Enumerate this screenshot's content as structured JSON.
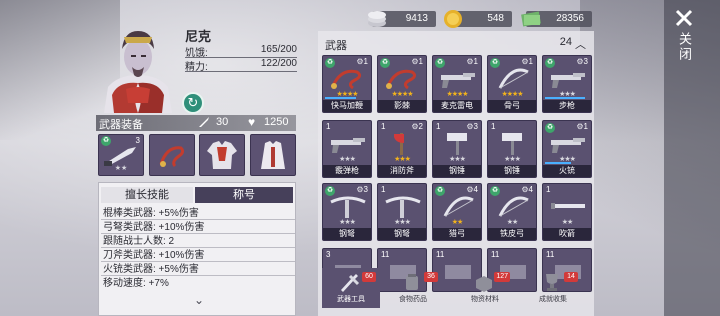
{
  "character": {
    "name": "尼克",
    "stats": [
      {
        "label": "饥饿:",
        "value": "165/200"
      },
      {
        "label": "精力:",
        "value": "122/200"
      }
    ]
  },
  "equipment": {
    "title": "武器装备",
    "attack": "30",
    "hp": "1250",
    "slots": [
      {
        "qty": "3",
        "stars": "★★"
      },
      {
        "qty": "",
        "stars": ""
      },
      {
        "qty": "",
        "stars": ""
      },
      {
        "qty": "",
        "stars": ""
      }
    ]
  },
  "skills": {
    "tabs": [
      "擅长技能",
      "称号"
    ],
    "lines": [
      "棍棒类武器: +5%伤害",
      "弓弩类武器: +10%伤害",
      "跟随战士人数: 2",
      "刀斧类武器: +10%伤害",
      "火铳类武器: +5%伤害",
      "移动速度: +7%"
    ]
  },
  "currency": [
    {
      "icon": "silver-coins-icon",
      "value": "9413"
    },
    {
      "icon": "gold-coin-icon",
      "value": "548"
    },
    {
      "icon": "cash-icon",
      "value": "28356"
    }
  ],
  "inventory": {
    "title": "武器",
    "count": "24",
    "items": [
      {
        "name": "快马加鞭",
        "qty": "",
        "recycle": true,
        "lvl": "1",
        "stars": "★★★★",
        "gold": true,
        "bar": 70
      },
      {
        "name": "影棘",
        "qty": "",
        "recycle": true,
        "lvl": "1",
        "stars": "★★★★",
        "gold": true,
        "bar": 0
      },
      {
        "name": "麦克雷电",
        "qty": "",
        "recycle": true,
        "lvl": "1",
        "stars": "★★★★",
        "gold": true,
        "bar": 0
      },
      {
        "name": "骨弓",
        "qty": "",
        "recycle": true,
        "lvl": "1",
        "stars": "★★★★",
        "gold": true,
        "bar": 0
      },
      {
        "name": "步枪",
        "qty": "",
        "recycle": true,
        "lvl": "3",
        "stars": "★★★",
        "gold": false,
        "bar": 90
      },
      {
        "name": "霰弹枪",
        "qty": "1",
        "recycle": false,
        "lvl": "",
        "stars": "★★★",
        "gold": false,
        "bar": 0
      },
      {
        "name": "消防斧",
        "qty": "1",
        "recycle": false,
        "lvl": "2",
        "stars": "★★★",
        "gold": true,
        "bar": 0
      },
      {
        "name": "钢锤",
        "qty": "1",
        "recycle": false,
        "lvl": "3",
        "stars": "★★★",
        "gold": false,
        "bar": 0
      },
      {
        "name": "钢锤",
        "qty": "1",
        "recycle": false,
        "lvl": "",
        "stars": "★★★",
        "gold": false,
        "bar": 0
      },
      {
        "name": "火铳",
        "qty": "",
        "recycle": true,
        "lvl": "1",
        "stars": "★★★",
        "gold": false,
        "bar": 60
      },
      {
        "name": "钢弩",
        "qty": "",
        "recycle": true,
        "lvl": "3",
        "stars": "★★★",
        "gold": false,
        "bar": 0
      },
      {
        "name": "钢弩",
        "qty": "1",
        "recycle": false,
        "lvl": "",
        "stars": "★★★",
        "gold": false,
        "bar": 0
      },
      {
        "name": "猎弓",
        "qty": "",
        "recycle": true,
        "lvl": "4",
        "stars": "★★",
        "gold": true,
        "bar": 0
      },
      {
        "name": "铁皮弓",
        "qty": "",
        "recycle": true,
        "lvl": "4",
        "stars": "★★",
        "gold": false,
        "bar": 0
      },
      {
        "name": "吹箭",
        "qty": "1",
        "recycle": false,
        "lvl": "",
        "stars": "★★",
        "gold": false,
        "bar": 0
      },
      {
        "name": "",
        "qty": "3",
        "recycle": false,
        "lvl": "",
        "stars": "",
        "gold": false,
        "bar": 0
      },
      {
        "name": "",
        "qty": "11",
        "recycle": false,
        "lvl": "",
        "stars": "",
        "gold": false,
        "bar": 0
      },
      {
        "name": "",
        "qty": "11",
        "recycle": false,
        "lvl": "",
        "stars": "",
        "gold": false,
        "bar": 0
      },
      {
        "name": "",
        "qty": "11",
        "recycle": false,
        "lvl": "",
        "stars": "",
        "gold": false,
        "bar": 0
      },
      {
        "name": "",
        "qty": "11",
        "recycle": false,
        "lvl": "",
        "stars": "",
        "gold": false,
        "bar": 0
      }
    ]
  },
  "categories": [
    {
      "label": "武器工具",
      "badge": "60",
      "active": true
    },
    {
      "label": "食物药品",
      "badge": "36",
      "active": false
    },
    {
      "label": "物资材料",
      "badge": "127",
      "active": false
    },
    {
      "label": "成就收集",
      "badge": "14",
      "active": false
    }
  ],
  "close": {
    "label": "关闭"
  },
  "colors": {
    "card": "#5a5170",
    "star_gold": "#f2b31c",
    "badge": "#d23a3a",
    "recycle": "#3ea56b"
  }
}
